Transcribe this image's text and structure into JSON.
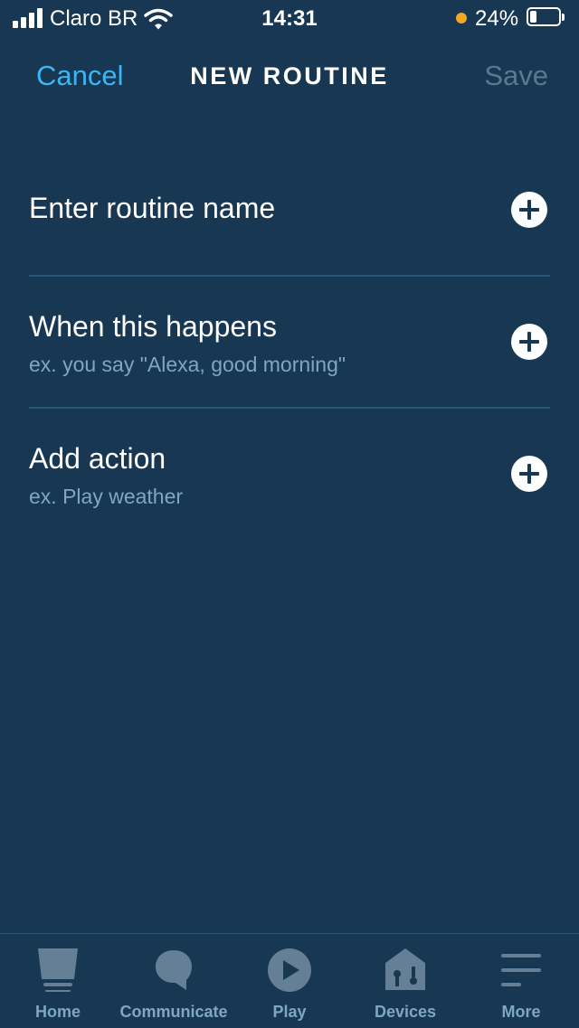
{
  "status_bar": {
    "carrier": "Claro BR",
    "time": "14:31",
    "battery_percent": "24%",
    "battery_level": 0.24,
    "icons": [
      "signal-icon",
      "wifi-icon",
      "orange-dot",
      "battery-icon"
    ]
  },
  "header": {
    "cancel_label": "Cancel",
    "title": "NEW ROUTINE",
    "save_label": "Save"
  },
  "rows": {
    "name": {
      "title": "Enter routine name",
      "icon": "plus-circle-icon"
    },
    "trigger": {
      "title": "When this happens",
      "subtitle": "ex. you say \"Alexa, good morning\"",
      "icon": "plus-circle-icon"
    },
    "action": {
      "title": "Add action",
      "subtitle": "ex. Play weather",
      "icon": "plus-circle-icon"
    }
  },
  "tabbar": {
    "tabs": [
      {
        "label": "Home",
        "icon": "home-icon"
      },
      {
        "label": "Communicate",
        "icon": "chat-bubble-icon"
      },
      {
        "label": "Play",
        "icon": "play-icon"
      },
      {
        "label": "Devices",
        "icon": "devices-house-icon"
      },
      {
        "label": "More",
        "icon": "menu-icon"
      }
    ]
  },
  "colors": {
    "background": "#173753",
    "accent": "#3bb6f4",
    "disabled": "#5a7890",
    "secondary_text": "#7fa6c2",
    "divider": "#2d5778",
    "tab_icon": "#647f96",
    "orange_dot": "#f5a623"
  }
}
